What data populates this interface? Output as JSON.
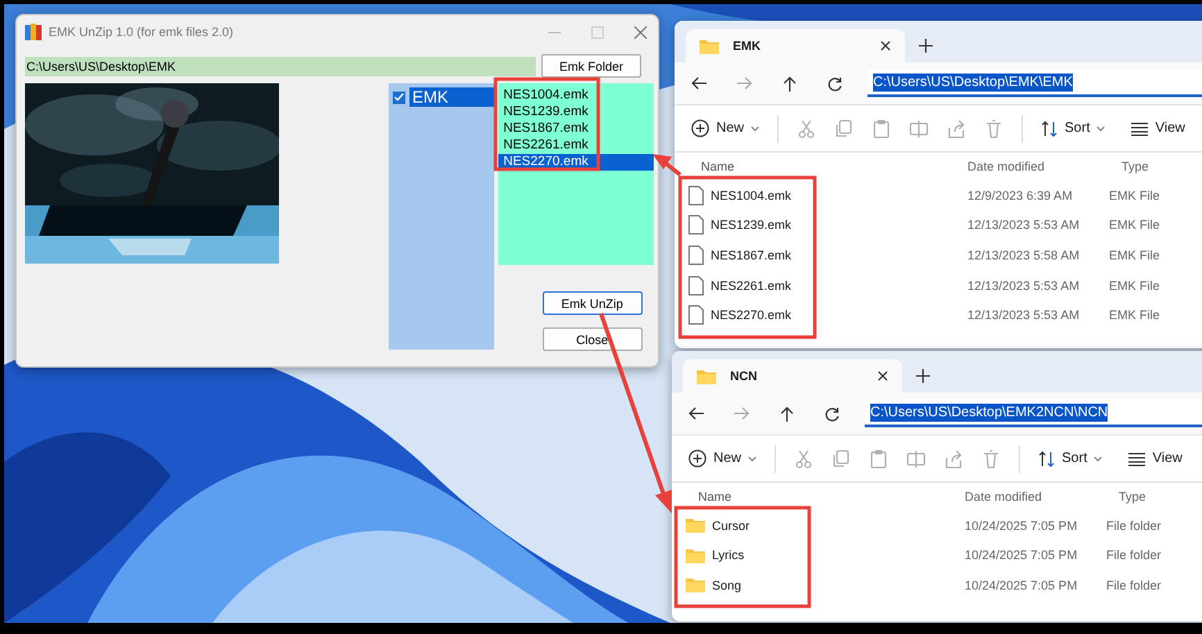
{
  "unzip_window": {
    "title": "EMK UnZip 1.0 (for emk files 2.0)",
    "path": "C:\\Users\\US\\Desktop\\EMK",
    "folder_button": "Emk Folder",
    "tree": [
      {
        "label": "EMK",
        "checked": true,
        "selected": true
      }
    ],
    "files": [
      {
        "name": "NES1004.emk",
        "selected": false
      },
      {
        "name": "NES1239.emk",
        "selected": false
      },
      {
        "name": "NES1867.emk",
        "selected": false
      },
      {
        "name": "NES2261.emk",
        "selected": false
      },
      {
        "name": "NES2270.emk",
        "selected": true
      }
    ],
    "unzip_button": "Emk UnZip",
    "close_button": "Close"
  },
  "explorer_windows": [
    {
      "tab": "EMK",
      "address": {
        "text": "C:\\Users\\US\\Desktop\\EMK\\EMK",
        "selected": true
      },
      "toolbar": {
        "new": "New",
        "sort": "Sort",
        "view": "View"
      },
      "columns": [
        "Name",
        "Date modified",
        "Type"
      ],
      "rows": [
        {
          "kind": "file",
          "name": "NES1004.emk",
          "date": "12/9/2023 6:39 AM",
          "type": "EMK File"
        },
        {
          "kind": "file",
          "name": "NES1239.emk",
          "date": "12/13/2023 5:53 AM",
          "type": "EMK File"
        },
        {
          "kind": "file",
          "name": "NES1867.emk",
          "date": "12/13/2023 5:58 AM",
          "type": "EMK File"
        },
        {
          "kind": "file",
          "name": "NES2261.emk",
          "date": "12/13/2023 5:53 AM",
          "type": "EMK File"
        },
        {
          "kind": "file",
          "name": "NES2270.emk",
          "date": "12/13/2023 5:53 AM",
          "type": "EMK File"
        }
      ]
    },
    {
      "tab": "NCN",
      "address": {
        "text": "C:\\Users\\US\\Desktop\\EMK2NCN\\NCN",
        "selected": true
      },
      "toolbar": {
        "new": "New",
        "sort": "Sort",
        "view": "View"
      },
      "columns": [
        "Name",
        "Date modified",
        "Type"
      ],
      "rows": [
        {
          "kind": "folder",
          "name": "Cursor",
          "date": "10/24/2025 7:05 PM",
          "type": "File folder"
        },
        {
          "kind": "folder",
          "name": "Lyrics",
          "date": "10/24/2025 7:05 PM",
          "type": "File folder"
        },
        {
          "kind": "folder",
          "name": "Song",
          "date": "10/24/2025 7:05 PM",
          "type": "File folder"
        }
      ]
    }
  ]
}
